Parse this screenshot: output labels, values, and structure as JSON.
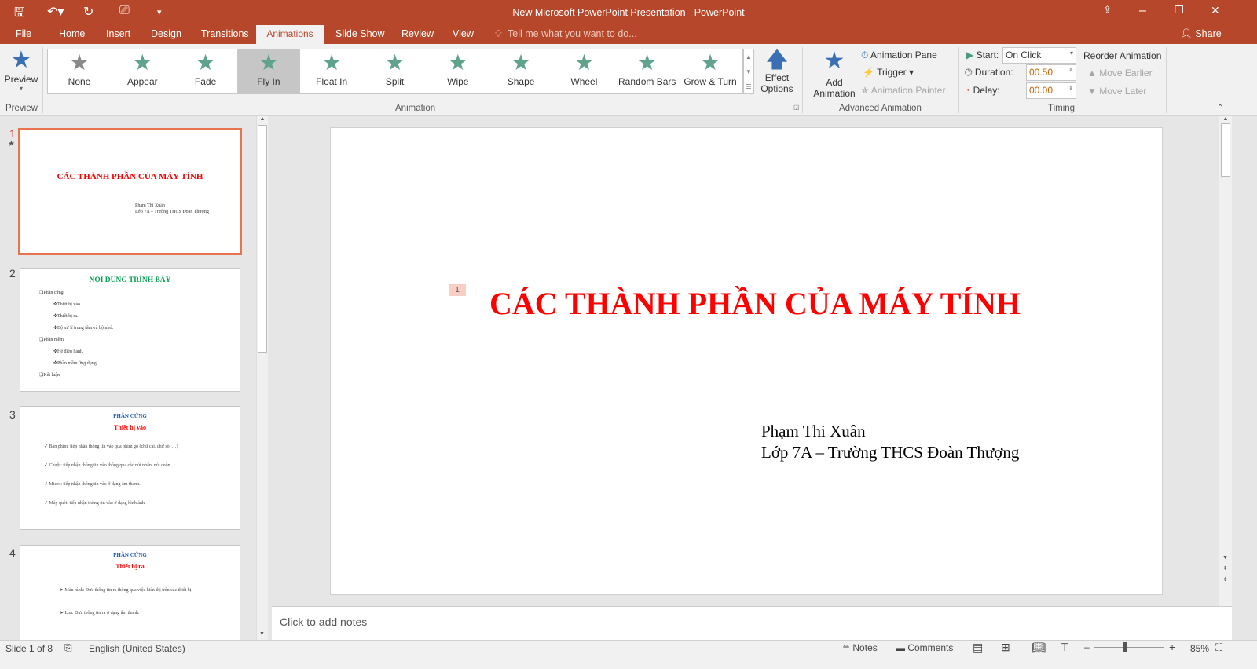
{
  "window": {
    "title": "New Microsoft PowerPoint Presentation - PowerPoint",
    "accent": "#B7472A"
  },
  "tabs": [
    "File",
    "Home",
    "Insert",
    "Design",
    "Transitions",
    "Animations",
    "Slide Show",
    "Review",
    "View"
  ],
  "active_tab": "Animations",
  "tell_me": "Tell me what you want to do...",
  "share": "Share",
  "ribbon": {
    "preview": {
      "label": "Preview",
      "group": "Preview"
    },
    "animations": [
      {
        "label": "None",
        "icon": "star-gray"
      },
      {
        "label": "Appear",
        "icon": "star-burst"
      },
      {
        "label": "Fade",
        "icon": "star-fade"
      },
      {
        "label": "Fly In",
        "icon": "star-arrow-up",
        "selected": true
      },
      {
        "label": "Float In",
        "icon": "star-arrow"
      },
      {
        "label": "Split",
        "icon": "star-split"
      },
      {
        "label": "Wipe",
        "icon": "star-wipe"
      },
      {
        "label": "Shape",
        "icon": "star-shape"
      },
      {
        "label": "Wheel",
        "icon": "star-wheel"
      },
      {
        "label": "Random Bars",
        "icon": "star-bars"
      },
      {
        "label": "Grow & Turn",
        "icon": "star-grow"
      }
    ],
    "effect_options": [
      "Effect",
      "Options"
    ],
    "animation_group": "Animation",
    "add_animation": [
      "Add",
      "Animation"
    ],
    "animation_pane": "Animation Pane",
    "trigger": "Trigger",
    "animation_painter": "Animation Painter",
    "advanced_group": "Advanced Animation",
    "start_label": "Start:",
    "start_value": "On Click",
    "duration_label": "Duration:",
    "duration_value": "00.50",
    "delay_label": "Delay:",
    "delay_value": "00.00",
    "reorder": "Reorder Animation",
    "move_earlier": "Move Earlier",
    "move_later": "Move Later",
    "timing_group": "Timing"
  },
  "thumbnails": [
    {
      "num": "1",
      "title": "CÁC THÀNH PHẦN CỦA MÁY TÍNH",
      "sub": [
        "Phạm Thi Xuân",
        "Lớp 7A – Trường THCS Đoàn Thượng"
      ]
    },
    {
      "num": "2",
      "title": "NỘI DUNG TRÌNH BÀY",
      "items": [
        "Phần cứng",
        "Thiết bị vào.",
        "Thiết bị ra.",
        "Bộ xử lí trung tâm và bộ nhớ.",
        "Phần mềm",
        "Hệ điều hành.",
        "Phần mềm ứng dụng.",
        "Kết luận"
      ]
    },
    {
      "num": "3",
      "title": "PHẦN CỨNG",
      "subtitle": "Thiết bị vào",
      "items": [
        "Bàn phím: tiếp nhận thông tin vào qua phím gõ (chữ cái, chữ số, …)",
        "Chuột: tiếp nhận thông tin vào thông qua các nút nhấn, nút cuộn.",
        "Micro: tiếp nhận thông tin vào ở dạng âm thanh.",
        "Máy quét: tiếp nhận thông tin vào ở dạng hình ảnh."
      ]
    },
    {
      "num": "4",
      "title": "PHẦN CỨNG",
      "subtitle": "Thiết bị ra",
      "items": [
        "Màn hình: Đưa thông tin ra thông qua việc hiển thị trên các thiết bị.",
        "Loa: Đưa thông tin ra ở dạng âm thanh."
      ]
    }
  ],
  "slide": {
    "anim_tag": "1",
    "title": "CÁC THÀNH PHẦN CỦA MÁY TÍNH",
    "line1": "Phạm Thi Xuân",
    "line2": "Lớp 7A – Trường THCS Đoàn Thượng",
    "title_color": "#FF0000"
  },
  "notes_placeholder": "Click to add notes",
  "status": {
    "slide": "Slide 1 of 8",
    "language": "English (United States)",
    "notes": "Notes",
    "comments": "Comments",
    "zoom": "85%",
    "zoom_level": 85
  }
}
